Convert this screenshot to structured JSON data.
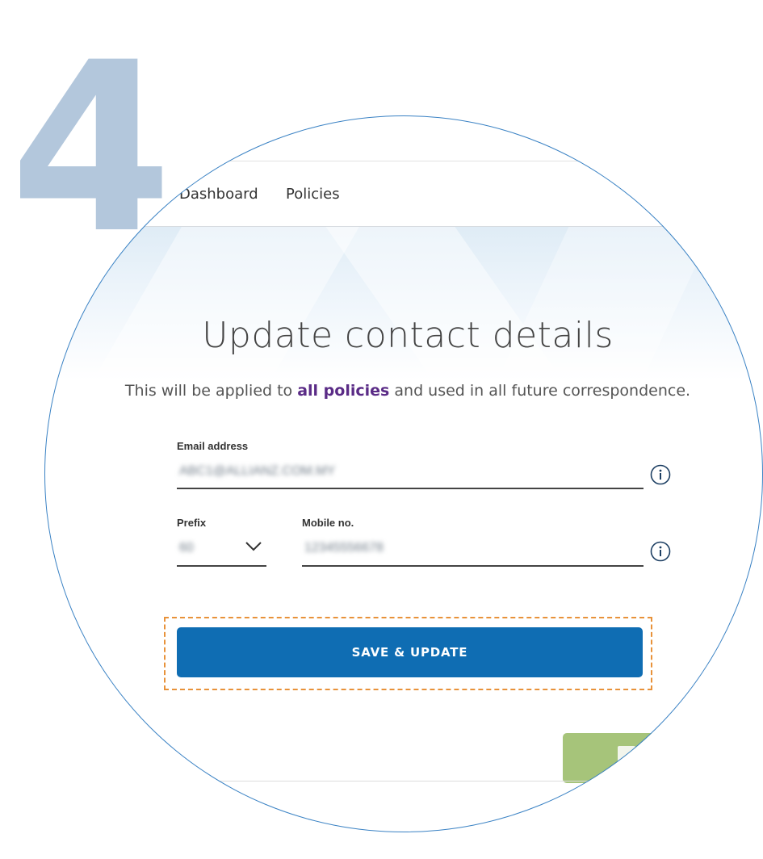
{
  "step": {
    "number": "4"
  },
  "nav": {
    "items": [
      "Dashboard",
      "Policies"
    ]
  },
  "page": {
    "title": "Update contact details",
    "subtitle_prefix": "This will be applied to ",
    "subtitle_bold": "all policies",
    "subtitle_suffix": " and used in all future correspondence."
  },
  "form": {
    "email": {
      "label": "Email address",
      "value": "ABC1@ALLIANZ.COM.MY"
    },
    "prefix": {
      "label": "Prefix",
      "value": "60"
    },
    "mobile": {
      "label": "Mobile no.",
      "value": "12345556678"
    }
  },
  "buttons": {
    "save_label": "SAVE & UPDATE"
  },
  "colors": {
    "primary": "#0f6db3",
    "highlight": "#e8923a",
    "emphasis": "#5a2b86",
    "step_number": "#b3c7dc",
    "secondary_button": "#a6c47a"
  },
  "icons": [
    "info-icon",
    "chevron-down-icon"
  ]
}
